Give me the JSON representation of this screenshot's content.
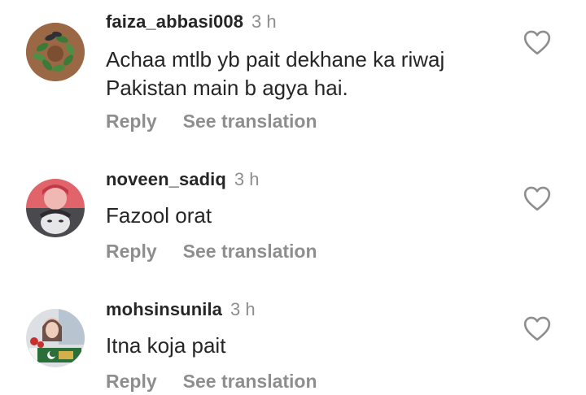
{
  "comments": [
    {
      "username": "faiza_abbasi008",
      "time": "3 h",
      "lines": [
        "Achaa mtlb yb pait dekhane ka riwaj",
        "Pakistan main b agya hai."
      ],
      "reply_label": "Reply",
      "translate_label": "See translation",
      "avatar_icon": "leaf-wreath-avatar",
      "like_icon": "heart-outline-icon"
    },
    {
      "username": "noveen_sadiq",
      "time": "3 h",
      "lines": [
        "Fazool orat"
      ],
      "reply_label": "Reply",
      "translate_label": "See translation",
      "avatar_icon": "portrait-collage-avatar",
      "like_icon": "heart-outline-icon"
    },
    {
      "username": "mohsinsunila",
      "time": "3 h",
      "lines": [
        "Itna koja pait"
      ],
      "reply_label": "Reply",
      "translate_label": "See translation",
      "avatar_icon": "flag-portrait-avatar",
      "like_icon": "heart-outline-icon"
    }
  ],
  "colors": {
    "text": "#262626",
    "muted": "#8e8e8e",
    "background": "#ffffff"
  }
}
